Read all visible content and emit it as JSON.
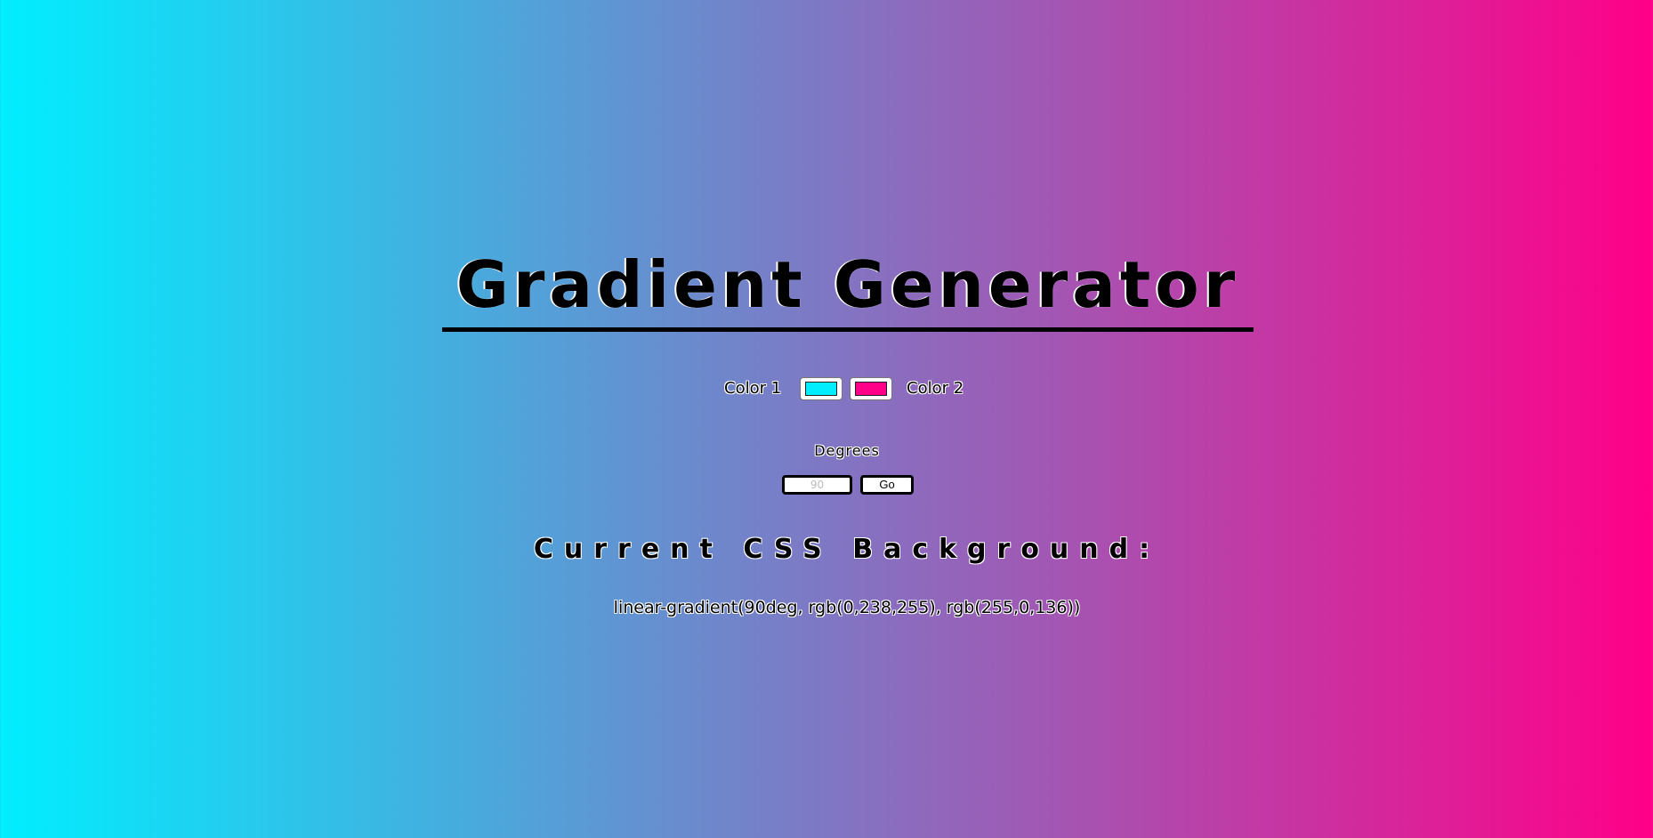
{
  "header": {
    "title": "Gradient Generator"
  },
  "colors": {
    "color1_label": "Color 1",
    "color2_label": "Color 2",
    "color1_value": "#00eeff",
    "color2_value": "#ff0088"
  },
  "degrees": {
    "label": "Degrees",
    "placeholder": "90",
    "value": "",
    "go_label": "Go"
  },
  "output": {
    "heading": "Current CSS Background:",
    "css_text": "linear-gradient(90deg, rgb(0,238,255), rgb(255,0,136))"
  },
  "theme": {
    "background_start": "#00eeff",
    "background_end": "#ff0088",
    "text_color": "#000000"
  }
}
